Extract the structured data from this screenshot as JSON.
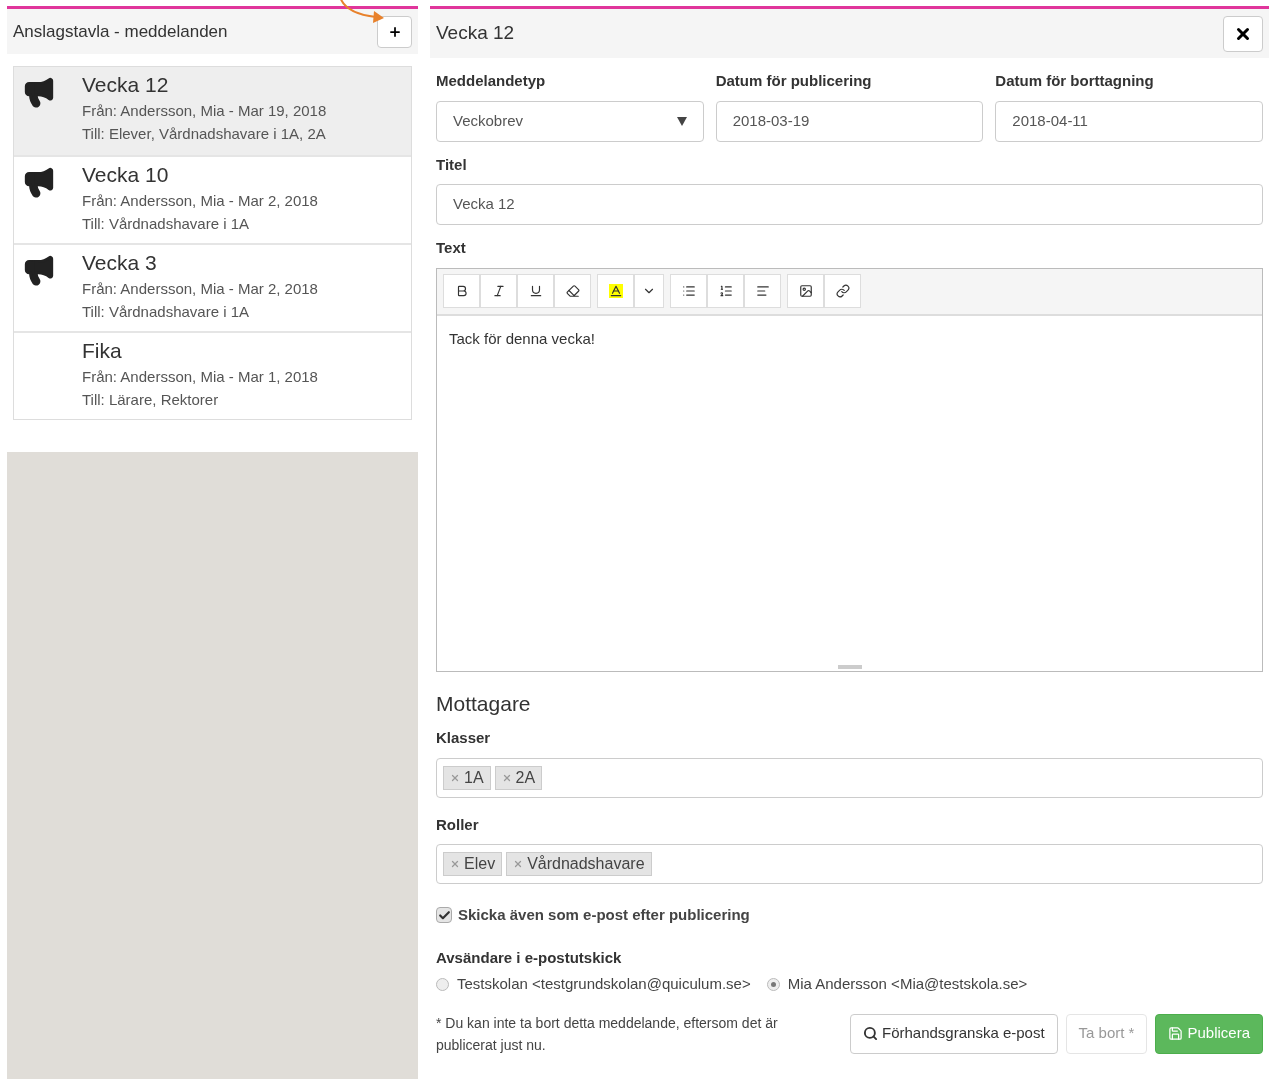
{
  "sidebar": {
    "title": "Anslagstavla - meddelanden",
    "items": [
      {
        "title": "Vecka 12",
        "from": "Från: Andersson, Mia - Mar 19, 2018",
        "to": "Till: Elever, Vårdnadshavare i 1A, 2A",
        "announcement": true,
        "selected": true
      },
      {
        "title": "Vecka 10",
        "from": "Från: Andersson, Mia - Mar 2, 2018",
        "to": "Till: Vårdnadshavare i 1A",
        "announcement": true,
        "selected": false
      },
      {
        "title": "Vecka 3",
        "from": "Från: Andersson, Mia - Mar 2, 2018",
        "to": "Till: Vårdnadshavare i 1A",
        "announcement": true,
        "selected": false
      },
      {
        "title": "Fika",
        "from": "Från: Andersson, Mia - Mar 1, 2018",
        "to": "Till: Lärare, Rektorer",
        "announcement": false,
        "selected": false
      }
    ]
  },
  "editor": {
    "title": "Vecka 12",
    "fields": [
      {
        "label": "Meddelandetyp",
        "value": "Veckobrev",
        "kind": "select"
      },
      {
        "label": "Datum för publicering",
        "value": "2018-03-19",
        "kind": "text"
      },
      {
        "label": "Datum för borttagning",
        "value": "2018-04-11",
        "kind": "text"
      }
    ],
    "title_field": {
      "label": "Titel",
      "value": "Vecka 12"
    },
    "text_field": {
      "label": "Text",
      "value": "Tack för denna vecka!",
      "toolbar": [
        {
          "buttons": [
            {
              "kind": "bold"
            },
            {
              "kind": "italic"
            },
            {
              "kind": "underline"
            },
            {
              "kind": "eraser"
            }
          ]
        },
        {
          "buttons": [
            {
              "kind": "highlight"
            },
            {
              "kind": "caret"
            }
          ]
        },
        {
          "buttons": [
            {
              "kind": "bullets"
            },
            {
              "kind": "numbers"
            },
            {
              "kind": "align"
            }
          ]
        },
        {
          "buttons": [
            {
              "kind": "image"
            },
            {
              "kind": "link"
            }
          ]
        }
      ]
    },
    "recipients": {
      "heading": "Mottagare",
      "groups": [
        {
          "label": "Klasser",
          "tags": [
            "1A",
            "2A"
          ]
        },
        {
          "label": "Roller",
          "tags": [
            "Elev",
            "Vårdnadshavare"
          ]
        }
      ]
    },
    "email_checkbox": {
      "label": "Skicka även som e-post efter publicering",
      "checked": true
    },
    "sender": {
      "label": "Avsändare i e-postutskick",
      "options": [
        {
          "label": "Testskolan <testgrundskolan@quiculum.se>",
          "selected": false
        },
        {
          "label": "Mia Andersson <Mia@testskola.se>",
          "selected": true
        }
      ]
    },
    "note": "* Du kan inte ta bort detta meddelande, eftersom det är publicerat just nu.",
    "buttons": [
      {
        "label": "Förhandsgranska e-post",
        "kind": "preview",
        "disabled": false
      },
      {
        "label": "Ta bort *",
        "kind": "delete",
        "disabled": true
      },
      {
        "label": "Publicera",
        "kind": "publish",
        "disabled": false
      }
    ]
  }
}
